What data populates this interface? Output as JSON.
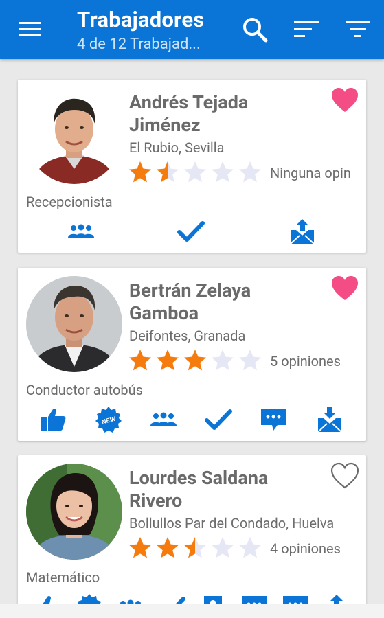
{
  "appbar": {
    "title": "Trabajadores",
    "subtitle": "4 de 12 Trabajad..."
  },
  "colors": {
    "primary": "#0a75d6",
    "star_filled": "#f57c0c",
    "star_empty": "#e6e7f5",
    "favorite": "#f44c84"
  },
  "workers": [
    {
      "name": "Andrés Tejada Jiménez",
      "location": "El Rubio, Sevilla",
      "rating": 1.5,
      "opinions": "Ninguna opin",
      "role": "Recepcionista",
      "favorite": true,
      "actions": [
        "group-icon",
        "check-icon",
        "mail-upload-icon"
      ]
    },
    {
      "name": "Bertrán Zelaya Gamboa",
      "location": "Deifontes, Granada",
      "rating": 3,
      "opinions": "5 opiniones",
      "role": "Conductor autobús",
      "favorite": true,
      "actions": [
        "thumbs-up-icon",
        "new-badge-icon",
        "group-icon",
        "check-icon",
        "chat-icon",
        "mail-download-icon"
      ]
    },
    {
      "name": "Lourdes Saldana Rivero",
      "location": "Bollullos Par del Condado, Huelva",
      "rating": 2.5,
      "opinions": "4 opiniones",
      "role": "Matemático",
      "favorite": false,
      "actions": [
        "thumbs-up-icon",
        "new-badge-icon",
        "group-icon",
        "check-icon",
        "contact-icon",
        "chat-icon",
        "chat-icon",
        "mail-upload-icon"
      ]
    }
  ],
  "new_badge_text": "NEW"
}
